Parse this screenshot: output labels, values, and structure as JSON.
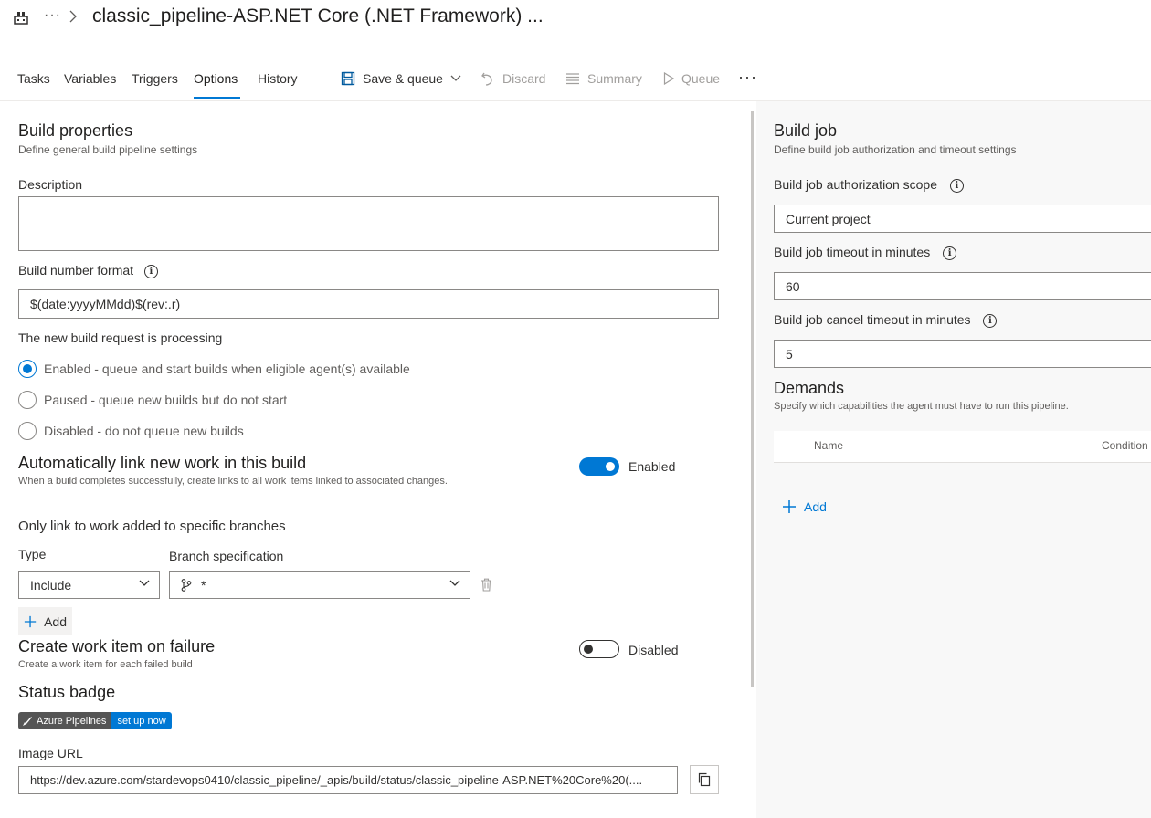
{
  "header": {
    "title": "classic_pipeline-ASP.NET Core (.NET Framework) ...",
    "more_label": "···"
  },
  "tabs": [
    {
      "label": "Tasks"
    },
    {
      "label": "Variables"
    },
    {
      "label": "Triggers"
    },
    {
      "label": "Options",
      "active": true
    },
    {
      "label": "History"
    }
  ],
  "toolbar": {
    "save_queue": "Save & queue",
    "discard": "Discard",
    "summary": "Summary",
    "queue": "Queue",
    "more": "···"
  },
  "build_properties": {
    "title": "Build properties",
    "subtitle": "Define general build pipeline settings",
    "description_label": "Description",
    "description_value": "",
    "build_number_label": "Build number format",
    "build_number_value": "$(date:yyyyMMdd)$(rev:.r)",
    "processing_label": "The new build request is processing",
    "options": [
      {
        "label": "Enabled - queue and start builds when eligible agent(s) available",
        "selected": true
      },
      {
        "label": "Paused - queue new builds but do not start",
        "selected": false
      },
      {
        "label": "Disabled - do not queue new builds",
        "selected": false
      }
    ]
  },
  "auto_link": {
    "title": "Automatically link new work in this build",
    "subtitle": "When a build completes successfully, create links to all work items linked to associated changes.",
    "toggle_state": "Enabled",
    "branches_title": "Only link to work added to specific branches",
    "type_label": "Type",
    "branch_label": "Branch specification",
    "type_value": "Include",
    "branch_value": "*",
    "add_label": "Add"
  },
  "work_item_failure": {
    "title": "Create work item on failure",
    "subtitle": "Create a work item for each failed build",
    "toggle_state": "Disabled"
  },
  "status_badge": {
    "title": "Status badge",
    "badge_left": "Azure Pipelines",
    "badge_right": "set up now",
    "image_url_label": "Image URL",
    "image_url": "https://dev.azure.com/stardevops0410/classic_pipeline/_apis/build/status/classic_pipeline-ASP.NET%20Core%20(...."
  },
  "build_job": {
    "title": "Build job",
    "subtitle": "Define build job authorization and timeout settings",
    "auth_scope_label": "Build job authorization scope",
    "auth_scope_value": "Current project",
    "timeout_label": "Build job timeout in minutes",
    "timeout_value": "60",
    "cancel_timeout_label": "Build job cancel timeout in minutes",
    "cancel_timeout_value": "5"
  },
  "demands": {
    "title": "Demands",
    "subtitle": "Specify which capabilities the agent must have to run this pipeline.",
    "columns": [
      "Name",
      "Condition"
    ],
    "add_label": "Add"
  },
  "colors": {
    "accent": "#0078d4",
    "badge_dark": "#555555"
  }
}
